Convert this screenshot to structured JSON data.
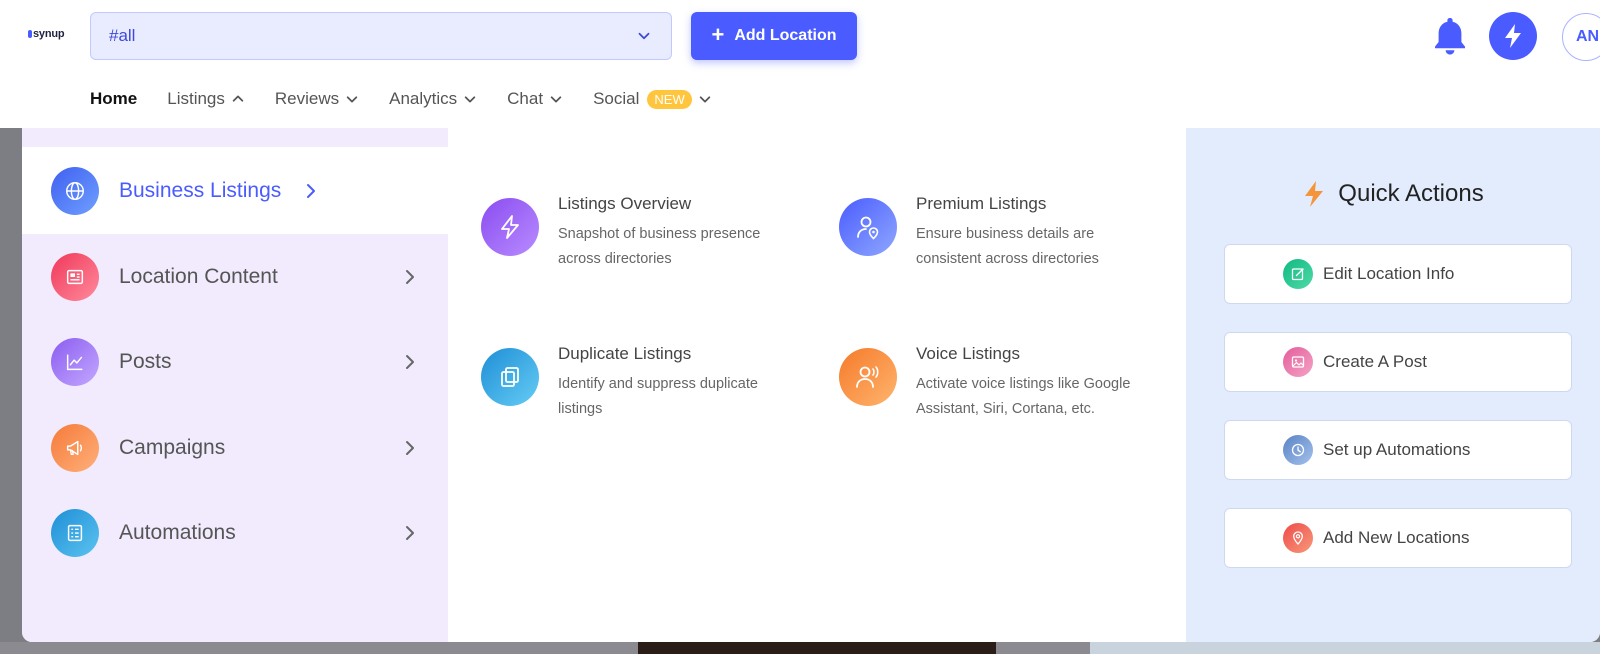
{
  "logo": {
    "text": "synup"
  },
  "header": {
    "location_select": {
      "value": "#all"
    },
    "add_location_label": "Add Location",
    "avatar_initials": "AN"
  },
  "nav": {
    "home": "Home",
    "listings": "Listings",
    "reviews": "Reviews",
    "analytics": "Analytics",
    "chat": "Chat",
    "social": "Social",
    "social_badge": "NEW"
  },
  "sidebar": {
    "items": [
      {
        "label": "Business Listings",
        "icon": "globe-icon",
        "color": "#4a6cf7"
      },
      {
        "label": "Location Content",
        "icon": "newspaper-icon",
        "color": "#f0506e"
      },
      {
        "label": "Posts",
        "icon": "chart-line-icon",
        "color": "#9c6ef0"
      },
      {
        "label": "Campaigns",
        "icon": "megaphone-icon",
        "color": "#f7894a"
      },
      {
        "label": "Automations",
        "icon": "document-list-icon",
        "color": "#2a9fd8"
      }
    ]
  },
  "cards": [
    {
      "title": "Listings Overview",
      "desc_line1": "Snapshot of business presence",
      "desc_line2": "across directories",
      "icon": "bolt-icon"
    },
    {
      "title": "Premium Listings",
      "desc_line1": "Ensure business details are",
      "desc_line2": "consistent across directories",
      "icon": "user-pin-icon"
    },
    {
      "title": "Duplicate Listings",
      "desc_line1": "Identify and suppress duplicate",
      "desc_line2": "listings",
      "icon": "copy-icon"
    },
    {
      "title": "Voice Listings",
      "desc_line1": "Activate voice listings like Google",
      "desc_line2": "Assistant, Siri, Cortana, etc.",
      "icon": "voice-icon"
    }
  ],
  "quick_actions": {
    "title": "Quick Actions",
    "items": [
      {
        "label": "Edit Location Info",
        "icon": "edit-icon"
      },
      {
        "label": "Create A Post",
        "icon": "image-icon"
      },
      {
        "label": "Set up Automations",
        "icon": "clock-icon"
      },
      {
        "label": "Add New Locations",
        "icon": "location-pin-icon"
      }
    ]
  },
  "colors": {
    "accent": "#4a5cff",
    "sidebar_bg": "#f1ebfd",
    "quick_bg": "#e3ecfd",
    "badge": "#ffc53d"
  }
}
